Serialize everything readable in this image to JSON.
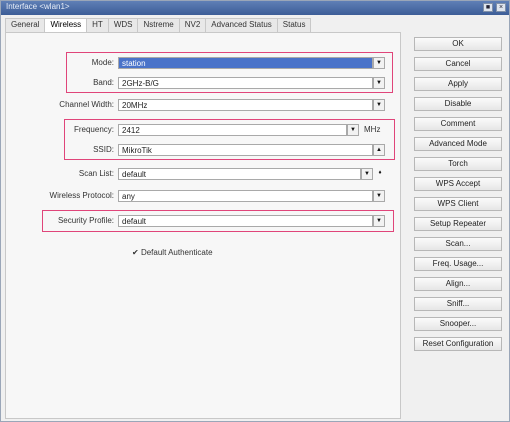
{
  "window": {
    "title": "Interface <wlan1>",
    "min_label": "■",
    "close_label": "×"
  },
  "tabs": [
    {
      "label": "General"
    },
    {
      "label": "Wireless"
    },
    {
      "label": "HT"
    },
    {
      "label": "WDS"
    },
    {
      "label": "Nstreme"
    },
    {
      "label": "NV2"
    },
    {
      "label": "Advanced Status"
    },
    {
      "label": "Status"
    }
  ],
  "form": {
    "mode": {
      "label": "Mode:",
      "value": "station"
    },
    "band": {
      "label": "Band:",
      "value": "2GHz-B/G"
    },
    "channel_width": {
      "label": "Channel Width:",
      "value": "20MHz"
    },
    "frequency": {
      "label": "Frequency:",
      "value": "2412",
      "unit": "MHz"
    },
    "ssid": {
      "label": "SSID:",
      "value": "MikroTik"
    },
    "scan_list": {
      "label": "Scan List:",
      "value": "default"
    },
    "wireless_protocol": {
      "label": "Wireless Protocol:",
      "value": "any"
    },
    "security_profile": {
      "label": "Security Profile:",
      "value": "default"
    },
    "default_authenticate": {
      "label": "Default Authenticate",
      "checked": true
    }
  },
  "icons": {
    "dropdown": "▼",
    "collapse": "▲",
    "updown": "♦",
    "check": "✔"
  },
  "buttons": [
    {
      "label": "OK"
    },
    {
      "label": "Cancel"
    },
    {
      "label": "Apply"
    },
    {
      "label": "Disable"
    },
    {
      "label": "Comment"
    },
    {
      "label": "Advanced Mode"
    },
    {
      "label": "Torch"
    },
    {
      "label": "WPS Accept"
    },
    {
      "label": "WPS Client"
    },
    {
      "label": "Setup Repeater"
    },
    {
      "label": "Scan..."
    },
    {
      "label": "Freq. Usage..."
    },
    {
      "label": "Align..."
    },
    {
      "label": "Sniff..."
    },
    {
      "label": "Snooper..."
    },
    {
      "label": "Reset Configuration"
    }
  ],
  "colors": {
    "highlight": "#e0457a",
    "selection": "#4a73c9"
  }
}
